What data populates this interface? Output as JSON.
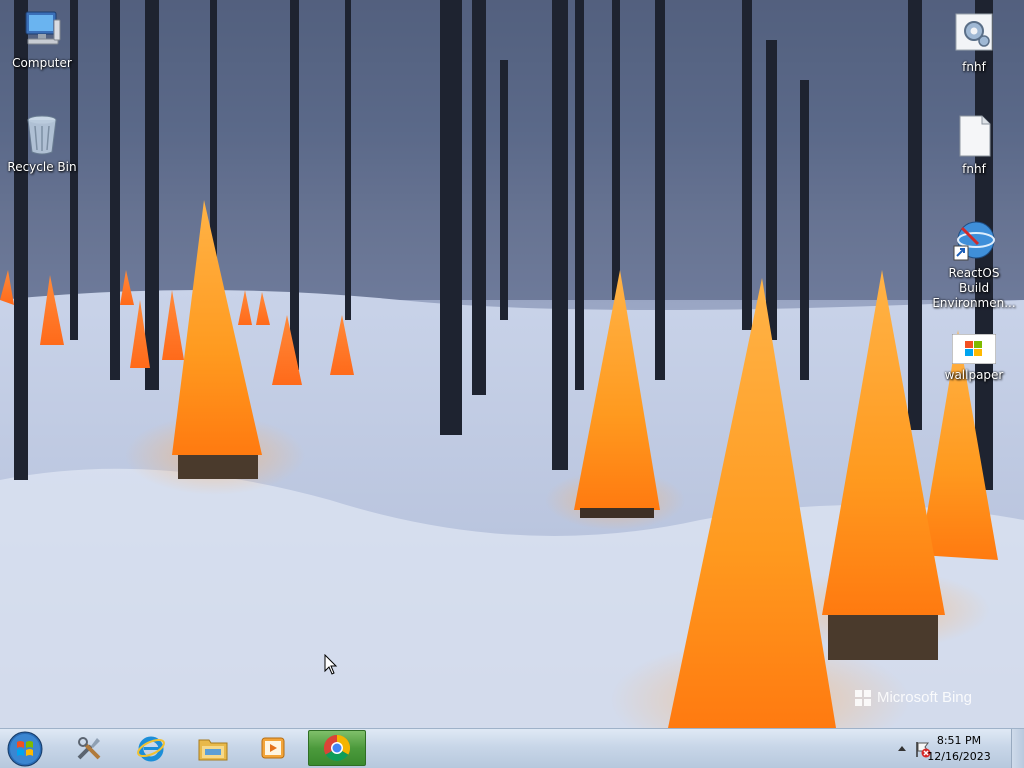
{
  "desktop": {
    "icons_left": [
      {
        "label": "Computer",
        "icon": "computer-icon"
      },
      {
        "label": "Recycle Bin",
        "icon": "recycle-bin-icon"
      }
    ],
    "icons_right": [
      {
        "label": "fnhf",
        "icon": "settings-file-icon"
      },
      {
        "label": "fnhf",
        "icon": "text-document-icon"
      },
      {
        "label": "ReactOS Build Environmen...",
        "icon": "shortcut-globe-icon"
      },
      {
        "label": "wallpaper",
        "icon": "image-file-icon"
      }
    ]
  },
  "wallpaper": {
    "watermark_text": "Microsoft Bing"
  },
  "taskbar": {
    "pinned": [
      {
        "name": "tools",
        "icon": "tools-icon"
      },
      {
        "name": "internet-explorer",
        "icon": "internet-explorer-icon"
      },
      {
        "name": "file-explorer",
        "icon": "folder-icon"
      },
      {
        "name": "media-player",
        "icon": "media-player-icon"
      },
      {
        "name": "chrome",
        "icon": "chrome-icon",
        "active": true
      }
    ],
    "clock_time": "8:51 PM",
    "clock_date": "12/16/2023"
  },
  "colors": {
    "taskbar_active": "#4c9a3c",
    "cone_glow": "#ff9a1f"
  }
}
